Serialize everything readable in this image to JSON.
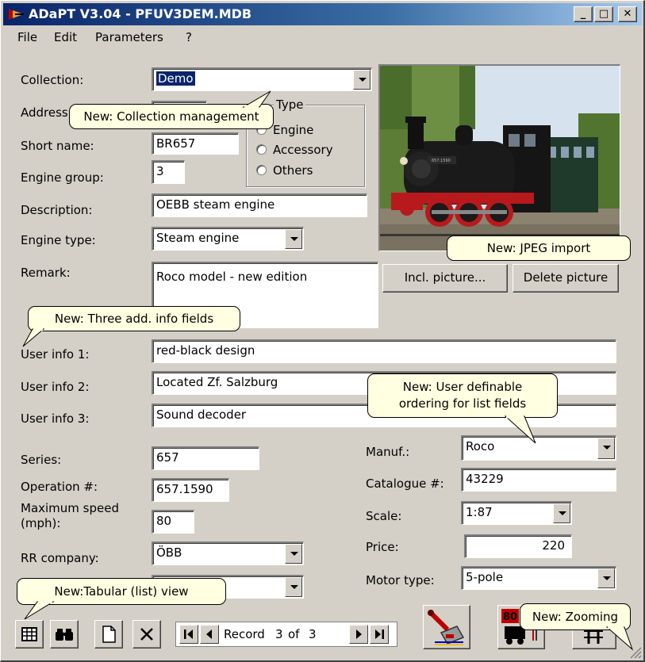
{
  "window": {
    "title": "ADaPT V3.04 - PFUV3DEM.MDB",
    "minimize_label": "_",
    "maximize_label": "□",
    "close_label": "✕"
  },
  "menu": {
    "items": [
      "File",
      "Edit",
      "Parameters",
      "?"
    ]
  },
  "form": {
    "collection": {
      "label": "Collection:",
      "value": "Demo"
    },
    "address": {
      "label": "Address:"
    },
    "short_name": {
      "label": "Short name:",
      "value": "BR657"
    },
    "engine_group": {
      "label": "Engine group:",
      "value": "3"
    },
    "type_group": {
      "title": "Type",
      "options": [
        "Engine",
        "Accessory",
        "Others"
      ]
    },
    "description": {
      "label": "Description:",
      "value": "OEBB steam engine"
    },
    "engine_type": {
      "label": "Engine type:",
      "value": "Steam engine"
    },
    "remark": {
      "label": "Remark:",
      "value": "Roco model - new edition"
    },
    "user_info_1": {
      "label": "User info 1:",
      "value": "red-black design"
    },
    "user_info_2": {
      "label": "User info 2:",
      "value": "Located Zf. Salzburg"
    },
    "user_info_3": {
      "label": "User info 3:",
      "value": "Sound decoder"
    },
    "series": {
      "label": "Series:",
      "value": "657"
    },
    "operation_no": {
      "label": "Operation #:",
      "value": "657.1590"
    },
    "max_speed": {
      "label_line1": "Maximum speed",
      "label_line2": "(mph):",
      "value": "80"
    },
    "rr_company": {
      "label": "RR company:",
      "value": "ÖBB"
    },
    "manufacturer": {
      "label": "Manuf.:",
      "value": "Roco"
    },
    "catalogue_no": {
      "label": "Catalogue #:",
      "value": "43229"
    },
    "scale": {
      "label": "Scale:",
      "value": "1:87"
    },
    "price": {
      "label": "Price:",
      "value": "220"
    },
    "motor_type": {
      "label": "Motor type:",
      "value": "5-pole"
    }
  },
  "picture": {
    "include_label": "Incl. picture...",
    "delete_label": "Delete picture",
    "engine_number": "657.1590"
  },
  "callouts": {
    "collection": "New: Collection management",
    "jpeg": "New: JPEG import",
    "info_fields": "New: Three add. info fields",
    "ordering_line1": "New: User definable",
    "ordering_line2": "ordering for list fields",
    "tabular": "New:Tabular (list) view",
    "zooming": "New: Zooming"
  },
  "toolbar": {
    "icons": [
      "table-grid-icon",
      "binoculars-icon",
      "new-document-icon",
      "delete-x-icon",
      "first-record-icon",
      "prev-record-icon",
      "next-record-icon",
      "last-record-icon",
      "railway-tool-icon",
      "locomotive-speed-icon",
      "zoom-track-icon"
    ],
    "record_label": "Record",
    "record_current": "3",
    "record_of": "of",
    "record_total": "3",
    "speed_badge": "80"
  }
}
